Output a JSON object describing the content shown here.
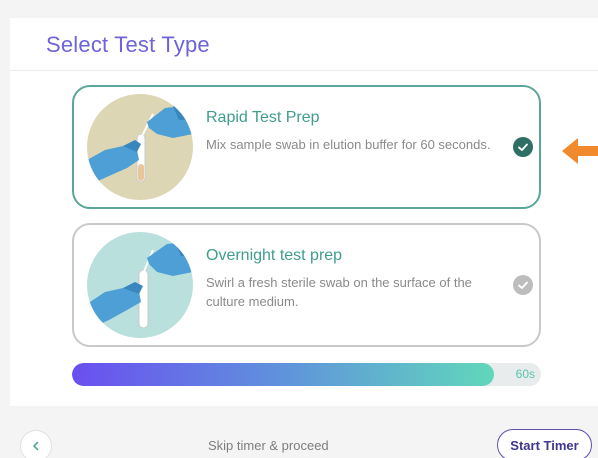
{
  "header": {
    "title": "Select Test Type"
  },
  "options": [
    {
      "title": "Rapid Test Prep",
      "description": "Mix sample swab in elution buffer for 60 seconds.",
      "selected": true,
      "illustration_bg": "#ddd6b4",
      "check_icon": "check-circle-icon"
    },
    {
      "title": "Overnight test prep",
      "description": "Swirl a fresh sterile swab on the surface of the culture medium.",
      "selected": false,
      "illustration_bg": "#b9e0dc",
      "check_icon": "check-circle-icon"
    }
  ],
  "timer": {
    "progress": 0.9,
    "label": "60s"
  },
  "footer": {
    "back_icon": "chevron-left-icon",
    "skip_label": "Skip timer & proceed",
    "start_label": "Start Timer"
  },
  "colors": {
    "title": "#6f63d9",
    "accent_teal": "#3f9d8e",
    "selected_border": "#5aa69a",
    "check_selected": "#2f6f66",
    "check_unselected": "#bdbdbd",
    "arrow": "#f08a2c",
    "glove": "#4d9fd6"
  }
}
